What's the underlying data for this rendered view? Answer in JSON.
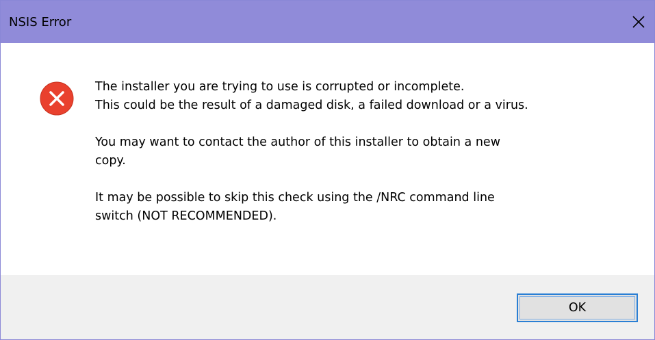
{
  "window": {
    "title": "NSIS Error",
    "close_icon": "close-icon"
  },
  "dialog": {
    "icon": "error-icon",
    "icon_color": "#e9412e",
    "messages": [
      "The installer you are trying to use is corrupted or incomplete.\nThis could be the result of a damaged disk, a failed download or a virus.",
      "You may want to contact the author of this installer to obtain a new\ncopy.",
      "It may be possible to skip this check using the /NRC command line\nswitch (NOT RECOMMENDED)."
    ]
  },
  "buttons": {
    "ok_label": "OK"
  },
  "colors": {
    "titlebar": "#908bd9",
    "footer": "#f0f0f0",
    "button_focus_border": "#2a7fd4"
  }
}
